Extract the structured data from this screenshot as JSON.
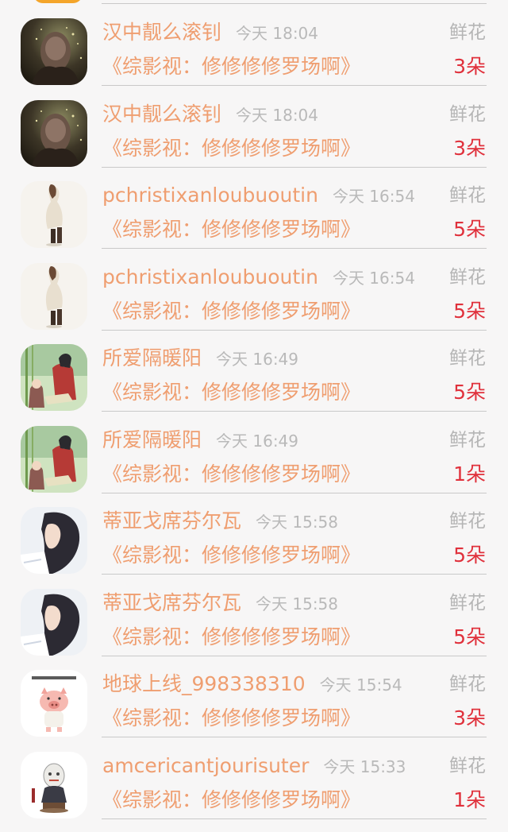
{
  "rows": [
    {
      "name": "汉中靓么滚钊",
      "time": "今天 18:04",
      "gift": "鲜花",
      "work": "《综影视：修修修修罗场啊》",
      "count": "3朵",
      "avatar": "dark-portrait-avatar"
    },
    {
      "name": "汉中靓么滚钊",
      "time": "今天 18:04",
      "gift": "鲜花",
      "work": "《综影视：修修修修罗场啊》",
      "count": "3朵",
      "avatar": "dark-portrait-avatar"
    },
    {
      "name": "pchristixanloubuoutin",
      "time": "今天 16:54",
      "gift": "鲜花",
      "work": "《综影视：修修修修罗场啊》",
      "count": "5朵",
      "avatar": "woman-in-dress-avatar"
    },
    {
      "name": "pchristixanloubuoutin",
      "time": "今天 16:54",
      "gift": "鲜花",
      "work": "《综影视：修修修修罗场啊》",
      "count": "5朵",
      "avatar": "woman-in-dress-avatar"
    },
    {
      "name": "所爱隔暖阳",
      "time": "今天 16:49",
      "gift": "鲜花",
      "work": "《综影视：修修修修罗场啊》",
      "count": "5朵",
      "avatar": "anime-couple-avatar"
    },
    {
      "name": "所爱隔暖阳",
      "time": "今天 16:49",
      "gift": "鲜花",
      "work": "《综影视：修修修修罗场啊》",
      "count": "1朵",
      "avatar": "anime-couple-avatar"
    },
    {
      "name": "蒂亚戈席芬尔瓦",
      "time": "今天 15:58",
      "gift": "鲜花",
      "work": "《综影视：修修修修罗场啊》",
      "count": "5朵",
      "avatar": "girl-side-profile-avatar"
    },
    {
      "name": "蒂亚戈席芬尔瓦",
      "time": "今天 15:58",
      "gift": "鲜花",
      "work": "《综影视：修修修修罗场啊》",
      "count": "5朵",
      "avatar": "girl-side-profile-avatar"
    },
    {
      "name": "地球上线_998338310",
      "time": "今天 15:54",
      "gift": "鲜花",
      "work": "《综影视：修修修修罗场啊》",
      "count": "3朵",
      "avatar": "cartoon-pig-avatar"
    },
    {
      "name": "amcericantjourisuter",
      "time": "今天 15:33",
      "gift": "鲜花",
      "work": "《综影视：修修修修罗场啊》",
      "count": "1朵",
      "avatar": "masked-figurine-avatar"
    }
  ],
  "colors": {
    "name": "#ef9e70",
    "time": "#b9b9b9",
    "gift_type": "#b5b5b5",
    "count": "#e0313c",
    "separator": "#c9c9c9",
    "background": "#f7f6f6"
  }
}
